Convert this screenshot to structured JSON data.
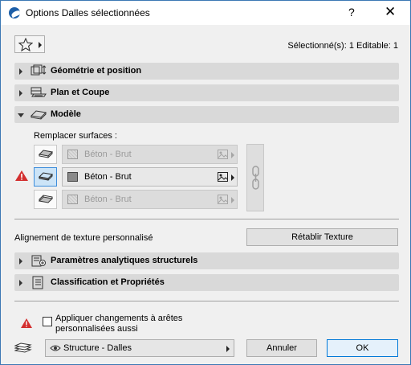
{
  "window": {
    "title": "Options Dalles sélectionnées",
    "help_label": "?",
    "close_label": "✕"
  },
  "header": {
    "favorites_icon": "star-icon",
    "selection_info": "Sélectionné(s): 1 Editable: 1"
  },
  "sections": {
    "geometry": {
      "label": "Géométrie et position",
      "expanded": false,
      "icon": "geometry-icon"
    },
    "plan": {
      "label": "Plan et Coupe",
      "expanded": false,
      "icon": "plan-section-icon"
    },
    "model": {
      "label": "Modèle",
      "expanded": true,
      "icon": "model-icon"
    },
    "analytics": {
      "label": "Paramètres analytiques structurels",
      "expanded": false,
      "icon": "structural-analytics-icon"
    },
    "classification": {
      "label": "Classification et Propriétés",
      "expanded": false,
      "icon": "classification-icon"
    }
  },
  "model": {
    "override_label": "Remplacer surfaces :",
    "surfaces": [
      {
        "icon": "top-surface-icon",
        "material": "Béton - Brut",
        "enabled": false
      },
      {
        "icon": "side-surface-icon",
        "material": "Béton - Brut",
        "enabled": true
      },
      {
        "icon": "bottom-surface-icon",
        "material": "Béton - Brut",
        "enabled": false
      }
    ],
    "chain_icon": "chain-link-icon",
    "warning_icon": "warning-icon"
  },
  "texture": {
    "label": "Alignement de texture personnalisé",
    "reset_label": "Rétablir Texture"
  },
  "footer": {
    "apply_edges_label_line1": "Appliquer changements à arêtes",
    "apply_edges_label_line2": "personnalisées aussi",
    "apply_edges_checked": false,
    "layer_value": "Structure - Dalles",
    "cancel_label": "Annuler",
    "ok_label": "OK"
  },
  "colors": {
    "accent": "#0078d7",
    "warning": "#d32f2f"
  }
}
